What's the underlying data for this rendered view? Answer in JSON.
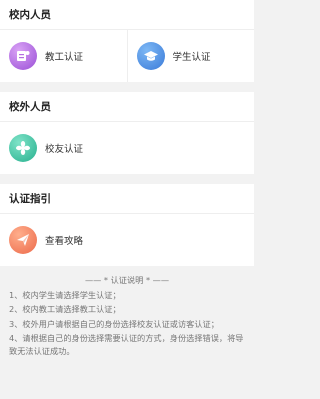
{
  "sections": {
    "internal": {
      "title": "校内人员",
      "teacher_label": "教工认证",
      "student_label": "学生认证"
    },
    "external": {
      "title": "校外人员",
      "alumni_label": "校友认证"
    },
    "guide": {
      "title": "认证指引",
      "guide_label": "查看攻略"
    }
  },
  "notes": {
    "title": "—— * 认证说明 * ——",
    "items": [
      "1、校内学生请选择学生认证；",
      "2、校内教工请选择教工认证；",
      "3、校外用户请根据自己的身份选择校友认证或访客认证；",
      "4、请根据自己的身份选择需要认证的方式，身份选择错误，将导致无法认证成功。"
    ]
  },
  "colors": {
    "teacher_icon": "#b46fe0",
    "student_icon": "#4a90e2",
    "alumni_icon": "#3cc6a6",
    "guide_icon": "#f0765a"
  }
}
